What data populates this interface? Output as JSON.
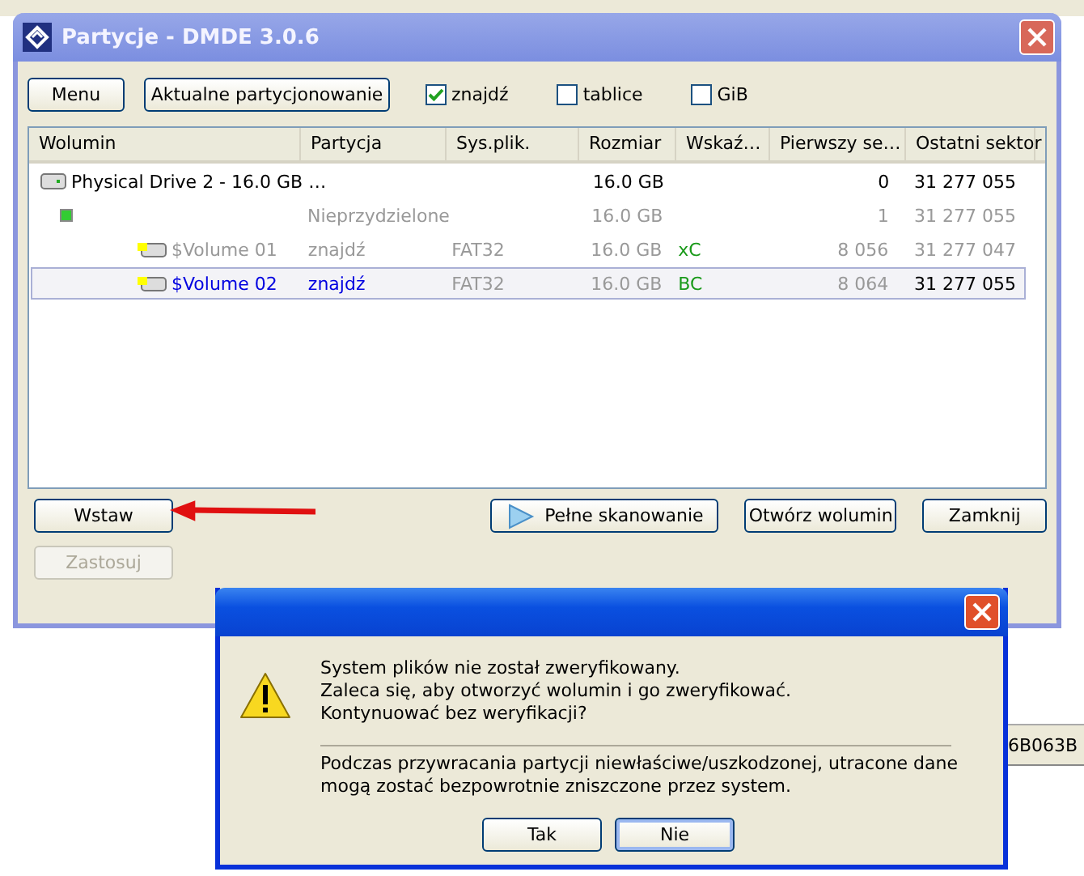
{
  "window": {
    "title": "Partycje - DMDE 3.0.6"
  },
  "toolbar": {
    "buttons": [
      "Menu",
      "Aktualne partycjonowanie"
    ],
    "checkboxes": [
      {
        "label": "znajdź",
        "checked": true
      },
      {
        "label": "tablice",
        "checked": false
      },
      {
        "label": "GiB",
        "checked": false
      }
    ]
  },
  "table": {
    "columns": [
      "Wolumin",
      "Partycja",
      "Sys.plik.",
      "Rozmiar",
      "Wskaź…",
      "Pierwszy se…",
      "Ostatni sektor"
    ],
    "rows": [
      {
        "kind": "drive",
        "cells": [
          "Physical Drive 2 - 16.0 GB …",
          "",
          "",
          "16.0 GB",
          "",
          "0",
          "31 277 055"
        ],
        "selected": false,
        "dim": false
      },
      {
        "kind": "free",
        "cells": [
          "",
          "Nieprzydzielone",
          "",
          "16.0 GB",
          "",
          "1",
          "31 277 055"
        ],
        "selected": false,
        "dim": true
      },
      {
        "kind": "volume",
        "cells": [
          "$Volume 01",
          "znajdź",
          "FAT32",
          "16.0 GB",
          "xC",
          "8 056",
          "31 277 047"
        ],
        "selected": false,
        "dim": true
      },
      {
        "kind": "volume",
        "cells": [
          "$Volume 02",
          "znajdź",
          "FAT32",
          "16.0 GB",
          "BC",
          "8 064",
          "31 277 055"
        ],
        "selected": true,
        "dim": false
      }
    ]
  },
  "buttons": [
    {
      "label": "Wstaw",
      "disabled": false
    },
    {
      "label": "Zastosuj",
      "disabled": true
    },
    {
      "label": "Pełne skanowanie",
      "disabled": false
    },
    {
      "label": "Otwórz wolumin",
      "disabled": false
    },
    {
      "label": "Zamknij",
      "disabled": false
    }
  ],
  "background_text": "6B063B",
  "dialog": {
    "lines": [
      "System plików nie został zweryfikowany.",
      "Zaleca się, aby otworzyć wolumin i go zweryfikować.",
      "Kontynuować bez weryfikacji?"
    ],
    "note": "Podczas przywracania partycji niewłaściwe/uszkodzonej, utracone dane mogą zostać bezpowrotnie zniszczone przez system.",
    "buttons": [
      "Tak",
      "Nie"
    ]
  }
}
